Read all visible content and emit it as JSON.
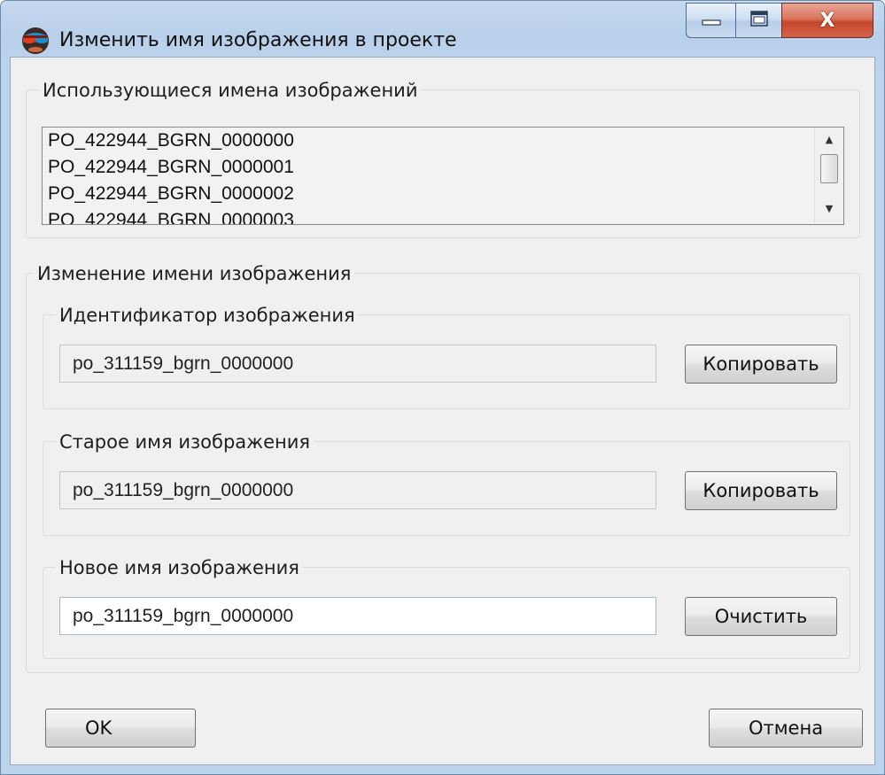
{
  "window": {
    "title": "Изменить имя изображения в проекте",
    "app_icon": "stereo-glasses-icon"
  },
  "caption": {
    "minimize_icon": "minimize-icon",
    "maximize_icon": "maximize-icon",
    "close_icon": "close-icon",
    "close_glyph": "X"
  },
  "used_names": {
    "title": "Использующиеся имена изображений",
    "items": [
      "PO_422944_BGRN_0000000",
      "PO_422944_BGRN_0000001",
      "PO_422944_BGRN_0000002",
      "PO_422944_BGRN_0000003"
    ],
    "scroll_up": "▲",
    "scroll_down": "▼"
  },
  "rename": {
    "title": "Изменение имени изображения",
    "identifier": {
      "title": "Идентификатор изображения",
      "value": "po_311159_bgrn_0000000",
      "button": "Копировать"
    },
    "old_name": {
      "title": "Старое имя изображения",
      "value": "po_311159_bgrn_0000000",
      "button": "Копировать"
    },
    "new_name": {
      "title": "Новое имя изображения",
      "value": "po_311159_bgrn_0000000",
      "button": "Очистить"
    }
  },
  "footer": {
    "ok": "OK",
    "cancel": "Отмена"
  },
  "colors": {
    "title_bar": "#bcd3ec",
    "close_button": "#c7472b",
    "client_background": "#f0f0f0"
  }
}
